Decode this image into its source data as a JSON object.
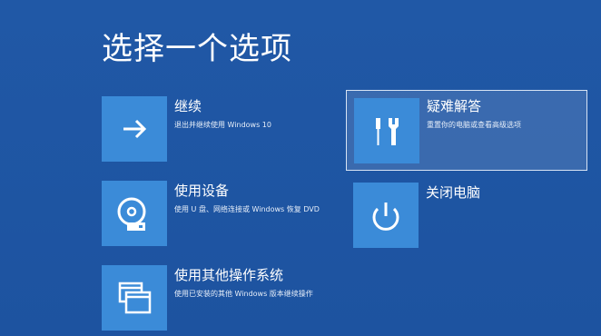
{
  "title": "选择一个选项",
  "options": [
    {
      "id": "continue",
      "title": "继续",
      "description": "退出并继续使用 Windows 10",
      "icon": "arrow-right-icon"
    },
    {
      "id": "use-device",
      "title": "使用设备",
      "description": "使用 U 盘、网络连接或 Windows 恢复 DVD",
      "icon": "disc-drive-icon"
    },
    {
      "id": "other-os",
      "title": "使用其他操作系统",
      "description": "使用已安装的其他 Windows 版本继续操作",
      "icon": "windows-stack-icon"
    },
    {
      "id": "troubleshoot",
      "title": "疑难解答",
      "description": "重置你的电脑或查看高级选项",
      "icon": "tools-icon",
      "selected": true
    },
    {
      "id": "power-off",
      "title": "关闭电脑",
      "description": "",
      "icon": "power-icon"
    }
  ],
  "colors": {
    "background": "#1f56a3",
    "tile": "#3b8bd8",
    "text": "#ffffff",
    "selection_border": "#d8e4f4"
  }
}
